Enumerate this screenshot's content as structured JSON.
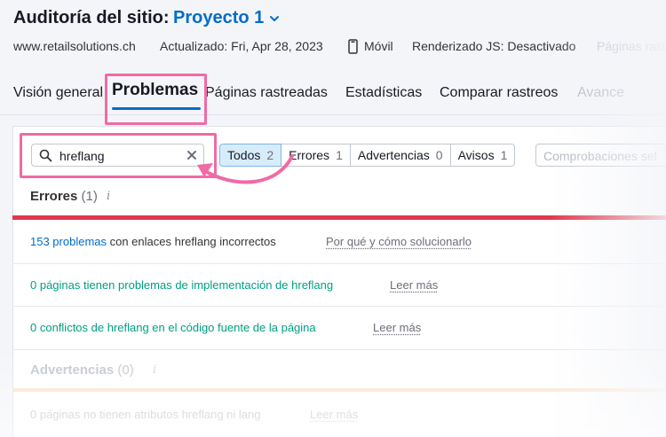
{
  "header": {
    "title": "Auditoría del sitio:",
    "project": "Proyecto 1",
    "domain": "www.retailsolutions.ch",
    "updated": "Actualizado: Fri, Apr 28, 2023",
    "device": "Móvil",
    "js_rendering": "Renderizado JS: Desactivado",
    "pages_crawled": "Páginas rast"
  },
  "tabs": [
    {
      "label": "Visión general"
    },
    {
      "label": "Problemas",
      "active": true
    },
    {
      "label": "Páginas rastreadas"
    },
    {
      "label": "Estadísticas"
    },
    {
      "label": "Comparar rastreos"
    },
    {
      "label": "Avance"
    }
  ],
  "search": {
    "value": "hreflang"
  },
  "filters": [
    {
      "label": "Todos",
      "count": "2",
      "active": true
    },
    {
      "label": "Errores",
      "count": "1"
    },
    {
      "label": "Advertencias",
      "count": "0"
    },
    {
      "label": "Avisos",
      "count": "1"
    }
  ],
  "checks_placeholder": "Comprobaciones sel",
  "errors_section": {
    "title": "Errores",
    "count": "(1)",
    "color": "#e0394f",
    "rows": [
      {
        "link": "153 problemas",
        "text": " con enlaces hreflang incorrectos",
        "action": "Por qué y cómo solucionarlo"
      },
      {
        "text": "0 páginas tienen problemas de implementación de hreflang",
        "action": "Leer más"
      },
      {
        "text": "0 conflictos de hreflang en el código fuente de la página",
        "action": "Leer más"
      }
    ]
  },
  "warnings_section": {
    "title": "Advertencias",
    "count": "(0)",
    "color": "#ff9f43",
    "rows": [
      {
        "text": "0 páginas no tienen atributos hreflang ni lang",
        "action": "Leer más"
      }
    ]
  },
  "colors": {
    "accent": "#006dca",
    "highlight": "#ef6ba6",
    "success_text": "#009f81"
  },
  "icons": [
    "chevron-down-icon",
    "phone-icon",
    "search-icon",
    "close-icon",
    "info-icon",
    "curved-arrow-icon"
  ]
}
